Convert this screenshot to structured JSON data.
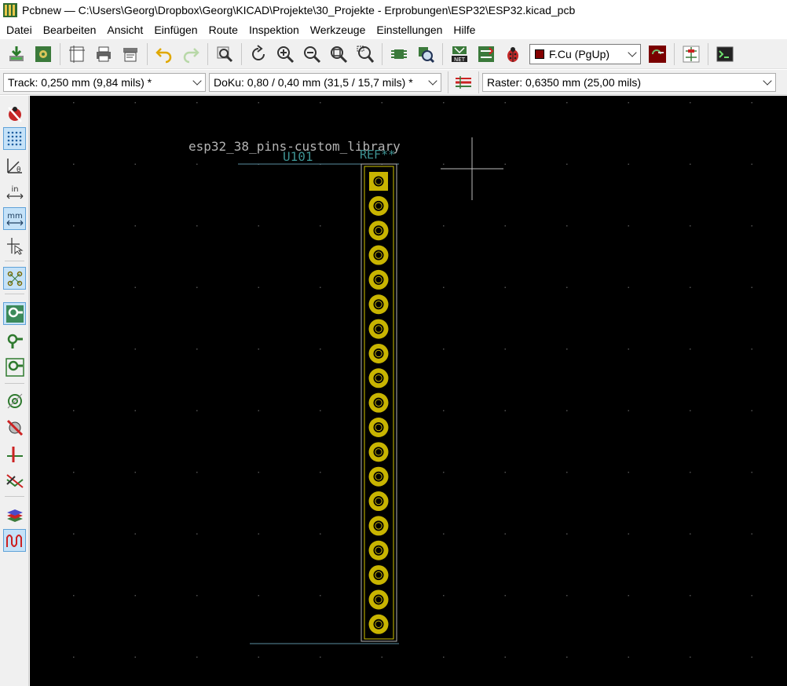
{
  "window": {
    "title": "Pcbnew — C:\\Users\\Georg\\Dropbox\\Georg\\KICAD\\Projekte\\30_Projekte - Erprobungen\\ESP32\\ESP32.kicad_pcb"
  },
  "menu": [
    "Datei",
    "Bearbeiten",
    "Ansicht",
    "Einfügen",
    "Route",
    "Inspektion",
    "Werkzeuge",
    "Einstellungen",
    "Hilfe"
  ],
  "toolbar": {
    "layer_select": "F.Cu (PgUp)"
  },
  "toolbar2": {
    "track": "Track: 0,250 mm (9,84 mils) *",
    "via": "DoKu: 0,80 / 0,40 mm (31,5 / 15,7 mils) *",
    "grid": "Raster: 0,6350 mm (25,00 mils)"
  },
  "board": {
    "footprint_value": "esp32_38_pins-custom_library",
    "footprint_ref_label": "U101",
    "footprint_ref_text": "REF**",
    "pin_count": 19,
    "first_pad_shape": "square",
    "colors": {
      "background": "#000000",
      "pad": "#c8b400",
      "silk": "#b4b4b4",
      "courtyard": "#5a8ea0",
      "ref_text": "#3d9191",
      "grid": "#505050"
    }
  }
}
